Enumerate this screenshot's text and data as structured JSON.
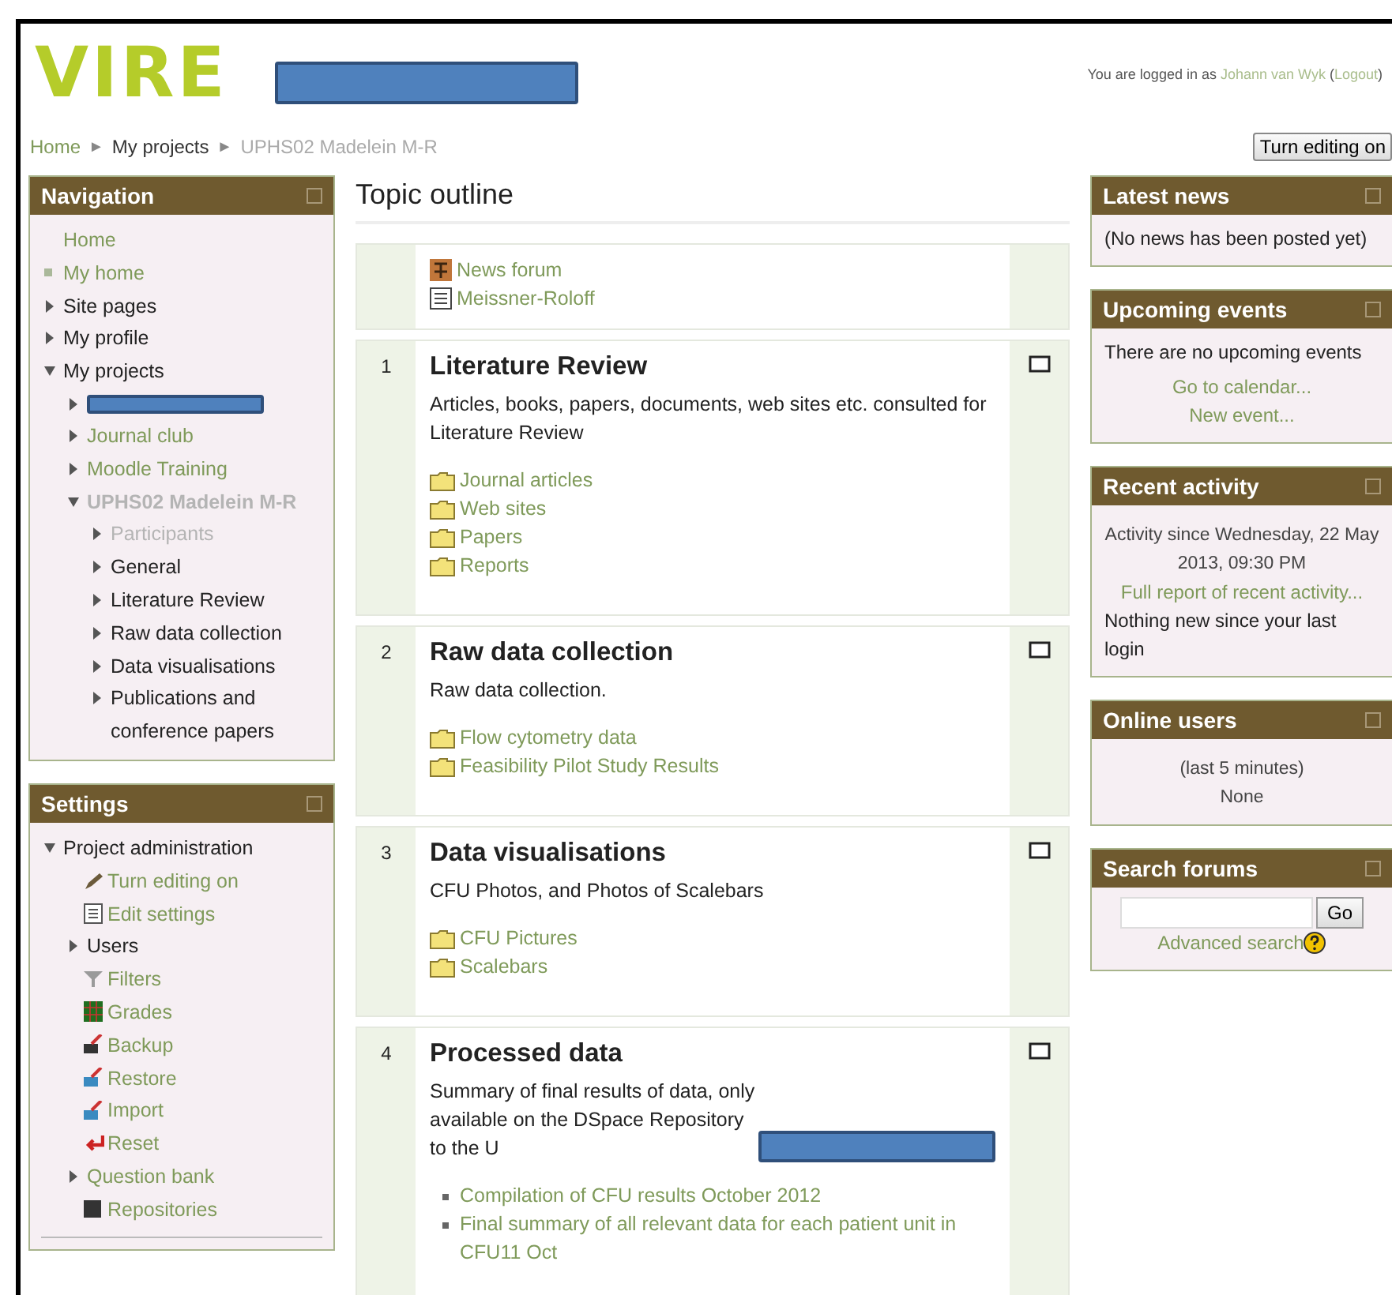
{
  "header": {
    "logo": "VIRE",
    "login_prefix": "You are logged in as",
    "user": "Johann van Wyk",
    "logout_open": "(",
    "logout": "Logout",
    "logout_close": ")"
  },
  "breadcrumb": {
    "separator": "►",
    "items": [
      {
        "label": "Home",
        "link": true,
        "greyed": false
      },
      {
        "label": "My projects",
        "link": false,
        "greyed": false
      },
      {
        "label": "UPHS02 Madelein M-R",
        "link": false,
        "greyed": true
      }
    ]
  },
  "edit_button": "Turn editing on",
  "navigation": {
    "title": "Navigation",
    "items": [
      {
        "label": "Home",
        "kind": "leaf",
        "link": true,
        "greyed": false
      },
      {
        "label": "My home",
        "kind": "bullet",
        "link": true,
        "greyed": false
      },
      {
        "label": "Site pages",
        "kind": "branch",
        "link": false,
        "greyed": false,
        "expanded": false
      },
      {
        "label": "My profile",
        "kind": "branch",
        "link": false,
        "greyed": false,
        "expanded": false
      },
      {
        "label": "My projects",
        "kind": "branch",
        "link": false,
        "greyed": false,
        "expanded": true,
        "children": [
          {
            "kind": "redacted",
            "expanded": false
          },
          {
            "label": "Journal club",
            "kind": "branch",
            "link": true,
            "greyed": false,
            "expanded": false
          },
          {
            "label": "Moodle Training",
            "kind": "branch",
            "link": true,
            "greyed": false,
            "expanded": false
          },
          {
            "label": "UPHS02 Madelein M-R",
            "kind": "current",
            "link": false,
            "greyed": true,
            "expanded": true,
            "children": [
              {
                "label": "Participants",
                "kind": "branch",
                "link": false,
                "greyed": true,
                "expanded": false
              },
              {
                "label": "General",
                "kind": "branch",
                "link": false,
                "greyed": false,
                "expanded": false
              },
              {
                "label": "Literature Review",
                "kind": "branch",
                "link": false,
                "greyed": false,
                "expanded": false
              },
              {
                "label": "Raw data collection",
                "kind": "branch",
                "link": false,
                "greyed": false,
                "expanded": false
              },
              {
                "label": "Data visualisations",
                "kind": "branch",
                "link": false,
                "greyed": false,
                "expanded": false
              },
              {
                "label": "Publications and conference papers",
                "kind": "branch",
                "link": false,
                "greyed": false,
                "expanded": false
              }
            ]
          }
        ]
      }
    ]
  },
  "settings": {
    "title": "Settings",
    "items": [
      {
        "label": "Project administration",
        "kind": "branch",
        "link": false,
        "expanded": true,
        "children": [
          {
            "label": "Turn editing on",
            "kind": "edit",
            "link": true
          },
          {
            "label": "Edit settings",
            "kind": "settings",
            "link": true
          },
          {
            "label": "Users",
            "kind": "branch",
            "link": false,
            "expanded": false
          },
          {
            "label": "Filters",
            "kind": "filter",
            "link": true
          },
          {
            "label": "Grades",
            "kind": "grades",
            "link": true
          },
          {
            "label": "Backup",
            "kind": "backup",
            "link": true
          },
          {
            "label": "Restore",
            "kind": "restore",
            "link": true
          },
          {
            "label": "Import",
            "kind": "restore",
            "link": true
          },
          {
            "label": "Reset",
            "kind": "reset",
            "link": true
          },
          {
            "label": "Question bank",
            "kind": "branch",
            "link": true,
            "expanded": false
          },
          {
            "label": "Repositories",
            "kind": "repository",
            "link": true
          }
        ]
      }
    ]
  },
  "topic_outline": {
    "title": "Topic outline",
    "sections": [
      {
        "resources": [
          {
            "label": "News forum",
            "kind": "forum"
          },
          {
            "label": "Meissner-Roloff",
            "kind": "page"
          }
        ]
      },
      {
        "number": "1",
        "title": "Literature Review",
        "summary": "Articles, books, papers, documents, web sites etc. consulted for Literature Review",
        "resources": [
          {
            "label": "Journal articles",
            "kind": "folder"
          },
          {
            "label": "Web sites",
            "kind": "folder"
          },
          {
            "label": "Papers",
            "kind": "folder"
          },
          {
            "label": "Reports",
            "kind": "folder"
          }
        ]
      },
      {
        "number": "2",
        "title": "Raw data collection",
        "summary": "Raw data collection.",
        "resources": [
          {
            "label": "Flow cytometry data",
            "kind": "folder"
          },
          {
            "label": "Feasibility Pilot Study Results",
            "kind": "folder"
          }
        ]
      },
      {
        "number": "3",
        "title": "Data visualisations",
        "summary": "CFU Photos, and Photos of Scalebars",
        "resources": [
          {
            "label": "CFU Pictures",
            "kind": "folder"
          },
          {
            "label": "Scalebars",
            "kind": "folder"
          }
        ]
      },
      {
        "number": "4",
        "title": "Processed data",
        "summary": "Summary of final results of data, only available on the DSpace Repository to the U",
        "summary_redacted": true,
        "resources": [
          {
            "label": "Compilation of CFU results October 2012",
            "kind": "bullet"
          },
          {
            "label": "Final summary of all relevant data for each patient unit in CFU11 Oct",
            "kind": "bullet"
          }
        ]
      }
    ]
  },
  "side_blocks": [
    {
      "title": "Latest news",
      "lines": [
        {
          "kind": "text",
          "text": "(No news has been posted yet)"
        }
      ]
    },
    {
      "title": "Upcoming events",
      "lines": [
        {
          "kind": "text",
          "text": "There are no upcoming events"
        },
        {
          "kind": "center-link",
          "text": "Go to calendar..."
        },
        {
          "kind": "center-link",
          "text": "New event..."
        }
      ]
    },
    {
      "title": "Recent activity",
      "lines": [
        {
          "kind": "center-note",
          "text": "Activity since Wednesday, 22 May 2013, 09:30 PM"
        },
        {
          "kind": "center-link",
          "text": "Full report of recent activity..."
        },
        {
          "kind": "text",
          "text": "Nothing new since your last login"
        }
      ]
    },
    {
      "title": "Online users",
      "lines": [
        {
          "kind": "center-note",
          "text": "(last 5 minutes)"
        },
        {
          "kind": "center-note",
          "text": "None"
        }
      ]
    },
    {
      "title": "Search forums",
      "lines": [
        {
          "kind": "search",
          "text": "Go"
        },
        {
          "kind": "help-link",
          "text": "Advanced search"
        }
      ]
    }
  ]
}
